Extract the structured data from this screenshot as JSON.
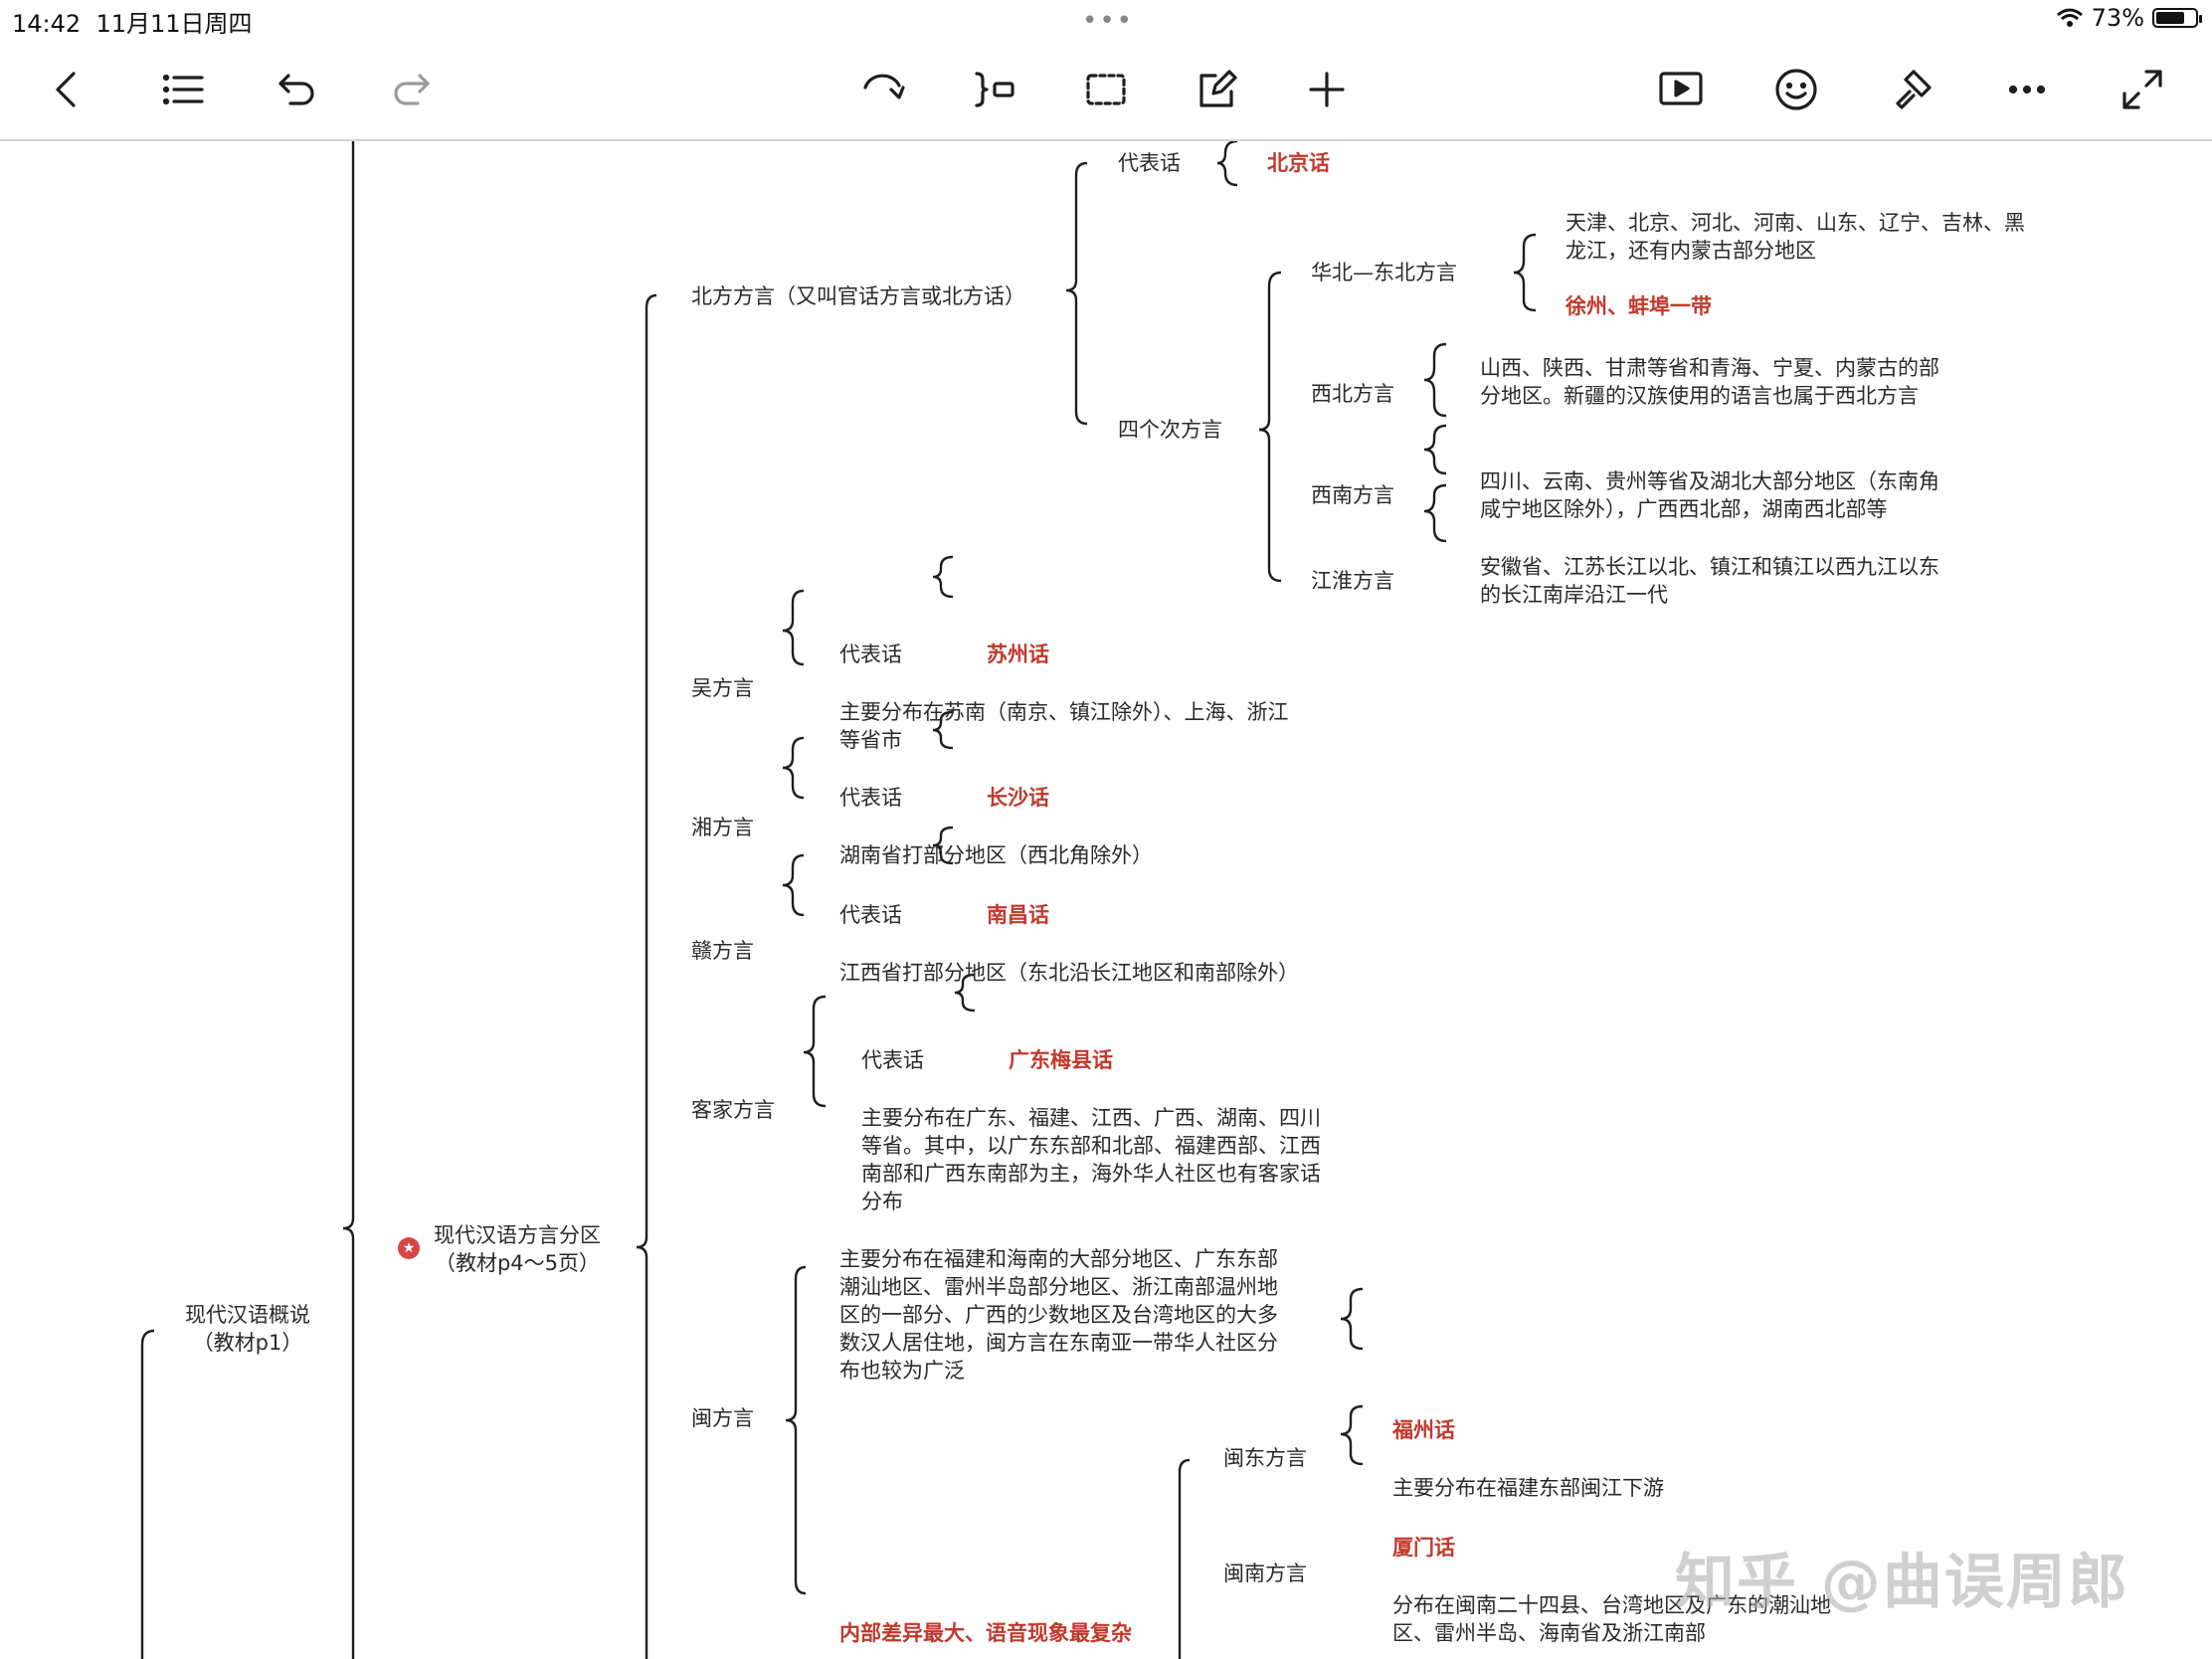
{
  "status_bar": {
    "time": "14:42",
    "date": "11月11日周四",
    "battery": "73%",
    "battery_level": 0.73
  },
  "toolbar": {
    "icons": [
      "back-icon",
      "outline-list-icon",
      "undo-icon",
      "redo-icon",
      "link-curve-icon",
      "summary-bracket-icon",
      "boundary-select-icon",
      "edit-note-icon",
      "add-icon",
      "present-play-icon",
      "emoji-icon",
      "format-brush-icon",
      "more-icon",
      "fullscreen-icon"
    ]
  },
  "mindmap": {
    "root": {
      "line1": "现代汉语概说",
      "line2": "（教材p1）"
    },
    "branch": {
      "line1": "现代汉语方言分区",
      "line2": "（教材p4～5页）"
    },
    "north": {
      "label": "北方方言（又叫官话方言或北方话）",
      "rep_label": "代表话",
      "rep_value": "北京话",
      "sub_label": "四个次方言",
      "huabei": {
        "label": "华北—东北方言",
        "text1": "天津、北京、河北、河南、山东、辽宁、吉林、黑龙江，还有内蒙古部分地区",
        "text2": "徐州、蚌埠一带"
      },
      "xibei": {
        "label": "西北方言",
        "text": "山西、陕西、甘肃等省和青海、宁夏、内蒙古的部分地区。新疆的汉族使用的语言也属于西北方言"
      },
      "xinan": {
        "label": "西南方言",
        "text": "四川、云南、贵州等省及湖北大部分地区（东南角咸宁地区除外），广西西北部，湖南西北部等"
      },
      "jianghuai": {
        "label": "江淮方言",
        "text": "安徽省、江苏长江以北、镇江和镇江以西九江以东的长江南岸沿江一代"
      }
    },
    "wu": {
      "label": "吴方言",
      "rep_label": "代表话",
      "rep_value": "苏州话",
      "area": "主要分布在苏南（南京、镇江除外）、上海、浙江等省市"
    },
    "xiang": {
      "label": "湘方言",
      "rep_label": "代表话",
      "rep_value": "长沙话",
      "area": "湖南省打部分地区（西北角除外）"
    },
    "gan": {
      "label": "赣方言",
      "rep_label": "代表话",
      "rep_value": "南昌话",
      "area": "江西省打部分地区（东北沿长江地区和南部除外）"
    },
    "kejia": {
      "label": "客家方言",
      "rep_label": "代表话",
      "rep_value": "广东梅县话",
      "area": "主要分布在广东、福建、江西、广西、湖南、四川等省。其中，以广东东部和北部、福建西部、江西南部和广西东南部为主，海外华人社区也有客家话分布"
    },
    "min": {
      "label": "闽方言",
      "area": "主要分布在福建和海南的大部分地区、广东东部潮汕地区、雷州半岛部分地区、浙江南部温州地区的一部分、广西的少数地区及台湾地区的大多数汉人居住地，闽方言在东南亚一带华人社区分布也较为广泛",
      "feature": "内部差异最大、语音现象最复杂",
      "mindong": {
        "label": "闽东方言",
        "rep": "福州话",
        "area": "主要分布在福建东部闽江下游"
      },
      "minnan": {
        "label": "闽南方言",
        "rep": "厦门话",
        "area": "分布在闽南二十四县、台湾地区及广东的潮汕地区、雷州半岛、海南省及浙江南部"
      }
    }
  },
  "watermark": "知乎 @曲误周郎"
}
